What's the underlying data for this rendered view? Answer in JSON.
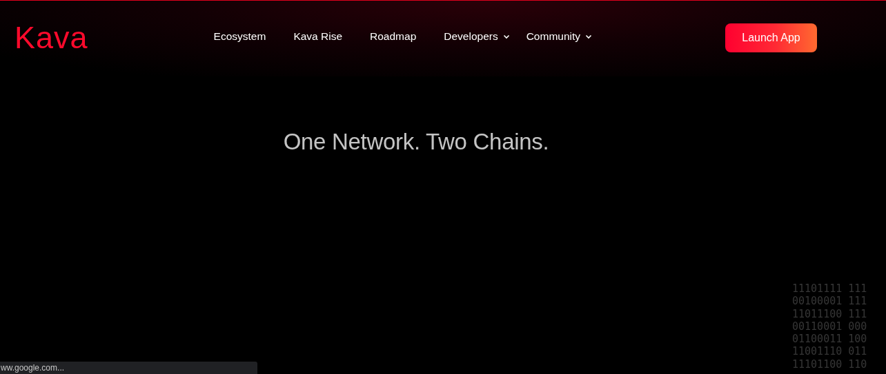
{
  "header": {
    "logo": "Kava",
    "nav": [
      {
        "label": "Ecosystem",
        "has_menu": false
      },
      {
        "label": "Kava Rise",
        "has_menu": false
      },
      {
        "label": "Roadmap",
        "has_menu": false
      },
      {
        "label": "Developers",
        "has_menu": true
      },
      {
        "label": "Community",
        "has_menu": true
      }
    ],
    "cta": "Launch App"
  },
  "hero": {
    "headline": "One Network. Two Chains."
  },
  "binary_rows": [
    "11101111 111",
    "00100001 111",
    "11011100 111",
    "00110001 000",
    "01100011 100",
    "11001110 011",
    "11101100 110"
  ],
  "status_bar": {
    "url": "ww.google.com..."
  }
}
